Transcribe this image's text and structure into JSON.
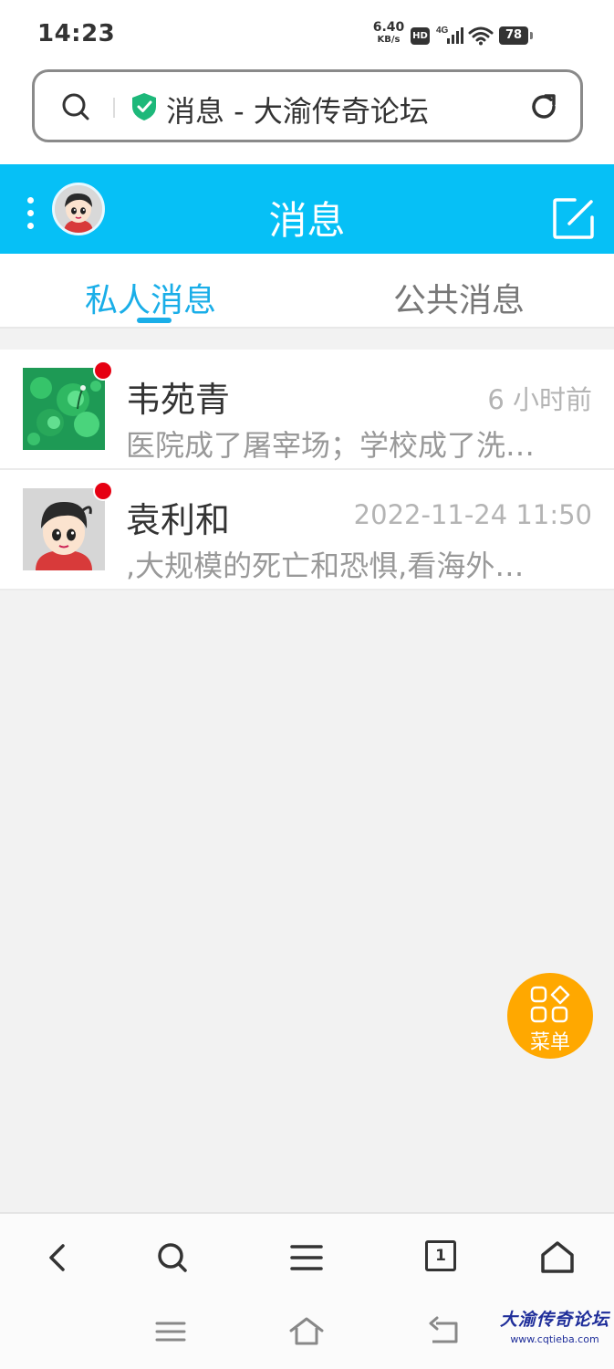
{
  "status_bar": {
    "time": "14:23",
    "net_speed_value": "6.40",
    "net_speed_unit": "KB/s",
    "hd_badge": "HD",
    "network_type": "4G",
    "battery": "78",
    "icons": [
      "signal-icon",
      "wifi-icon",
      "battery-icon"
    ]
  },
  "address_bar": {
    "title": "消息 - 大渝传奇论坛",
    "icons": [
      "search-icon",
      "shield-check-icon",
      "reload-icon"
    ],
    "shield_color": "#1db87a"
  },
  "header": {
    "title": "消息",
    "background_color": "#06c0f6",
    "icons": [
      "kebab-menu-icon",
      "avatar",
      "compose-icon"
    ]
  },
  "tabs": [
    {
      "label": "私人消息",
      "active": true
    },
    {
      "label": "公共消息",
      "active": false
    }
  ],
  "accent_color": "#1aaee8",
  "messages": [
    {
      "name": "韦苑青",
      "time": "6 小时前",
      "preview": "医院成了屠宰场；学校成了洗…",
      "unread": true,
      "avatar": "lotus-leaf-photo"
    },
    {
      "name": "袁利和",
      "time": "2022-11-24 11:50",
      "preview": ",大规模的死亡和恐惧,看海外…",
      "unread": true,
      "avatar": "cartoon-boy-avatar"
    }
  ],
  "floating_menu": {
    "label": "菜单",
    "color": "#ffa800",
    "icon": "grid-menu-icon"
  },
  "browser_toolbar": {
    "icons": [
      "back-icon",
      "search-icon",
      "menu-icon",
      "tabs-icon",
      "home-icon"
    ],
    "tab_count": "1"
  },
  "system_nav": {
    "icons": [
      "recent-apps-icon",
      "home-icon",
      "back-icon"
    ]
  },
  "watermark": {
    "title": "大渝传奇论坛",
    "url": "www.cqtieba.com"
  }
}
